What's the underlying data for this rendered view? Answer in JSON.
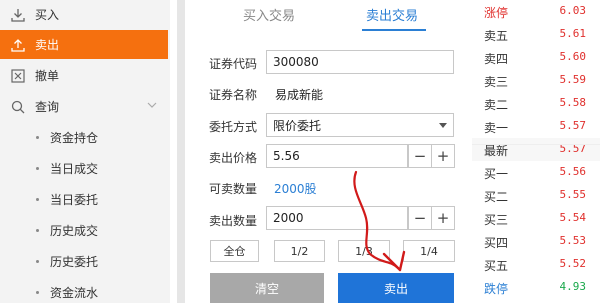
{
  "sidebar": {
    "items": [
      {
        "label": "买入",
        "icon": "download-icon"
      },
      {
        "label": "卖出",
        "icon": "upload-icon",
        "active": true
      },
      {
        "label": "撤单",
        "icon": "cancel-box-icon"
      },
      {
        "label": "查询",
        "icon": "search-icon"
      }
    ],
    "sub_items": [
      "资金持仓",
      "当日成交",
      "当日委托",
      "历史成交",
      "历史委托",
      "资金流水"
    ]
  },
  "tabs": {
    "buy": "买入交易",
    "sell": "卖出交易"
  },
  "form": {
    "code_label": "证券代码",
    "code_value": "300080",
    "name_label": "证券名称",
    "name_value": "易成新能",
    "method_label": "委托方式",
    "method_value": "限价委托",
    "price_label": "卖出价格",
    "price_value": "5.56",
    "avail_label": "可卖数量",
    "avail_value": "2000股",
    "qty_label": "卖出数量",
    "qty_value": "2000",
    "minus": "−",
    "plus": "+",
    "quick": [
      "全仓",
      "1/2",
      "1/3",
      "1/4"
    ],
    "clear_button": "清空",
    "sell_button": "卖出"
  },
  "quote": [
    {
      "name": "涨停",
      "price": "6.03",
      "name_color": "red",
      "price_color": "red"
    },
    {
      "name": "卖五",
      "price": "5.61",
      "price_color": "red"
    },
    {
      "name": "卖四",
      "price": "5.60",
      "price_color": "red"
    },
    {
      "name": "卖三",
      "price": "5.59",
      "price_color": "red"
    },
    {
      "name": "卖二",
      "price": "5.58",
      "price_color": "red"
    },
    {
      "name": "卖一",
      "price": "5.57",
      "price_color": "red"
    },
    {
      "name": "最新",
      "price": "5.57",
      "price_color": "red",
      "highlight": true
    },
    {
      "name": "买一",
      "price": "5.56",
      "price_color": "red"
    },
    {
      "name": "买二",
      "price": "5.55",
      "price_color": "red"
    },
    {
      "name": "买三",
      "price": "5.54",
      "price_color": "red"
    },
    {
      "name": "买四",
      "price": "5.53",
      "price_color": "red"
    },
    {
      "name": "买五",
      "price": "5.52",
      "price_color": "red"
    },
    {
      "name": "跌停",
      "price": "4.93",
      "name_color": "blue",
      "price_color": "green"
    }
  ],
  "colors": {
    "accent": "#f5700f",
    "sell_blue": "#1f74d8",
    "up_red": "#e0302d",
    "down_green": "#19a84b"
  }
}
